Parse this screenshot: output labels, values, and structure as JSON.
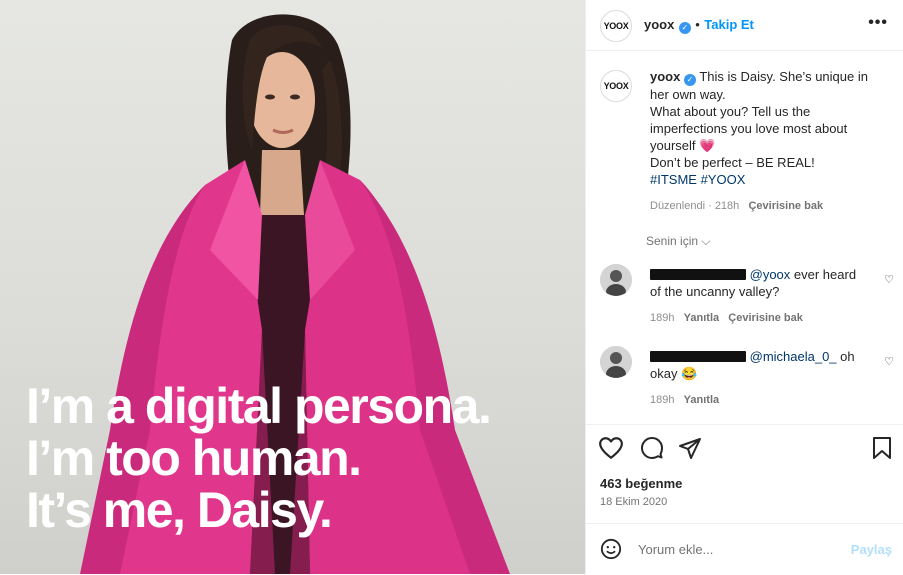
{
  "post": {
    "overlay_lines": [
      "I’m a digital persona.",
      "I’m too human.",
      "It’s me, Daisy."
    ]
  },
  "header": {
    "avatar_text": "YOOX",
    "username": "yoox",
    "separator": "•",
    "follow_label": "Takip Et",
    "more_label": "•••"
  },
  "caption": {
    "avatar_text": "YOOX",
    "username": "yoox",
    "line1": "This is Daisy. She’s unique in her own way.",
    "line2": "What about you? Tell us the imperfections you love most about yourself 💗",
    "line3": "Don’t be perfect – BE REAL!",
    "hashtags": "#ITSME #YOOX",
    "edited": "Düzenlendi · 218h",
    "translate": "Çevirisine bak"
  },
  "for_you": "Senin için ⌵",
  "comments": [
    {
      "mention": "@yoox",
      "text": " ever heard of the uncanny valley?",
      "time": "189h",
      "reply": "Yanıtla",
      "translate": "Çevirisine bak"
    },
    {
      "mention": "@michaela_0_",
      "text": " oh okay 😂",
      "time": "189h",
      "reply": "Yanıtla"
    }
  ],
  "stats": {
    "likes": "463 beğenme",
    "date": "18 Ekim 2020"
  },
  "composer": {
    "placeholder": "Yorum ekle...",
    "share_label": "Paylaş"
  },
  "colors": {
    "accent": "#0095f6",
    "coat": "#e0388f",
    "hashtag": "#00376b"
  }
}
